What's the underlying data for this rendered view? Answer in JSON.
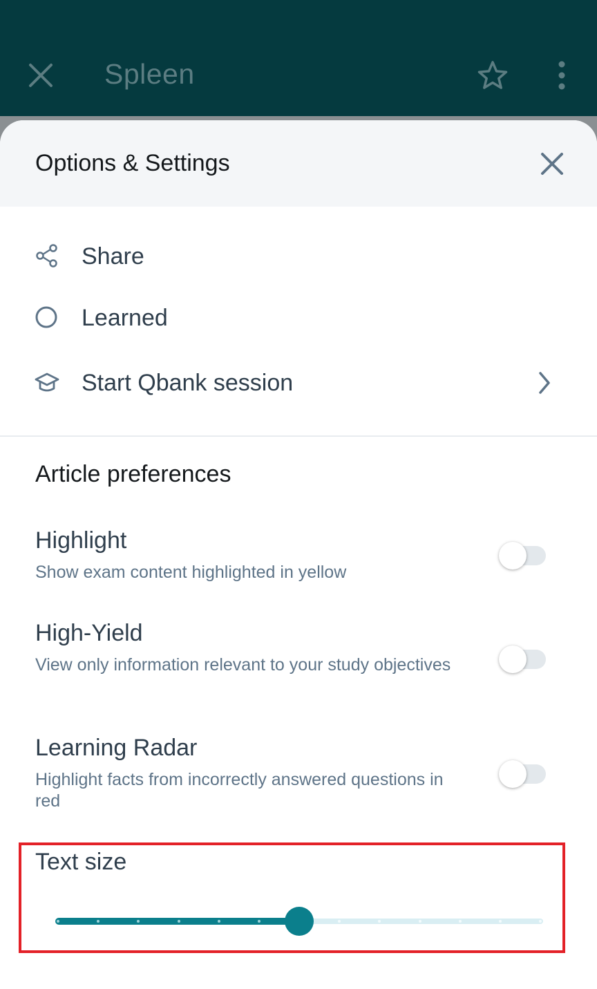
{
  "app_bar": {
    "title": "Spleen",
    "close_icon": "close-icon",
    "star_icon": "star-icon",
    "more_icon": "more-vertical-icon",
    "background": "#053a3f"
  },
  "sheet": {
    "title": "Options & Settings",
    "close_icon": "close-icon",
    "actions": [
      {
        "label": "Share",
        "icon": "share-icon"
      },
      {
        "label": "Learned",
        "icon": "circle-icon"
      },
      {
        "label": "Start Qbank session",
        "icon": "graduation-cap-icon",
        "trailing_icon": "chevron-right-icon"
      }
    ]
  },
  "article_preferences": {
    "title": "Article preferences",
    "items": [
      {
        "title": "Highlight",
        "description": "Show exam content highlighted in yellow",
        "enabled": false
      },
      {
        "title": "High-Yield",
        "description": "View only information relevant to your study objectives",
        "enabled": false
      },
      {
        "title": "Learning Radar",
        "description": "Highlight facts from incorrectly answered questions in red",
        "enabled": false
      }
    ]
  },
  "text_size": {
    "label": "Text size",
    "steps": 13,
    "selected_step": 6,
    "accent": "#0b7f8c",
    "highlight_color": "#e32128"
  }
}
